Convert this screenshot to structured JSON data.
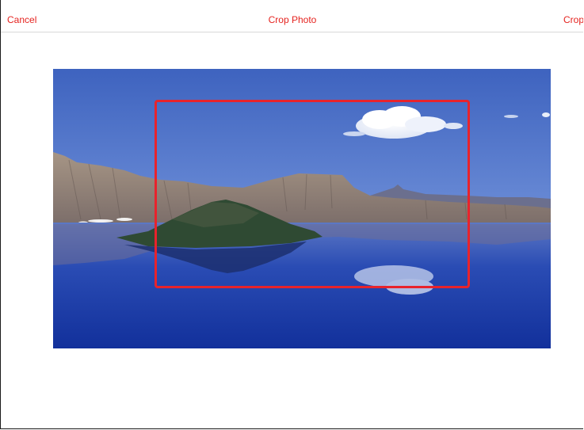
{
  "navbar": {
    "cancel_label": "Cancel",
    "title": "Crop Photo",
    "crop_label": "Crop"
  },
  "colors": {
    "accent": "#e5231f",
    "crop_frame": "#e8232c",
    "sky": "#4f74c8",
    "water": "#1d3fa6"
  },
  "photo": {
    "subject": "lake-island-landscape"
  }
}
